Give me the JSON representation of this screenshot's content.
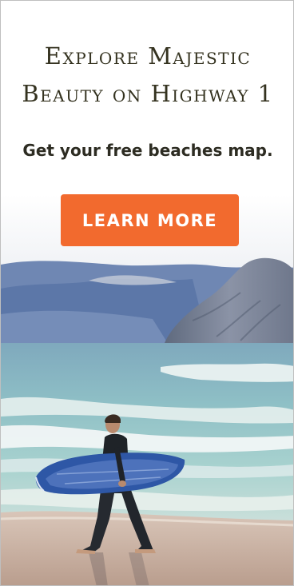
{
  "ad": {
    "headline_line1": "Explore Majestic",
    "headline_line2": "Beauty on Highway 1",
    "subline": "Get your free beaches map.",
    "cta_label": "LEARN MORE"
  },
  "colors": {
    "cta_background": "#f26a2e",
    "cta_text": "#ffffff",
    "headline_text": "#34321f",
    "subline_text": "#2d2c22"
  }
}
